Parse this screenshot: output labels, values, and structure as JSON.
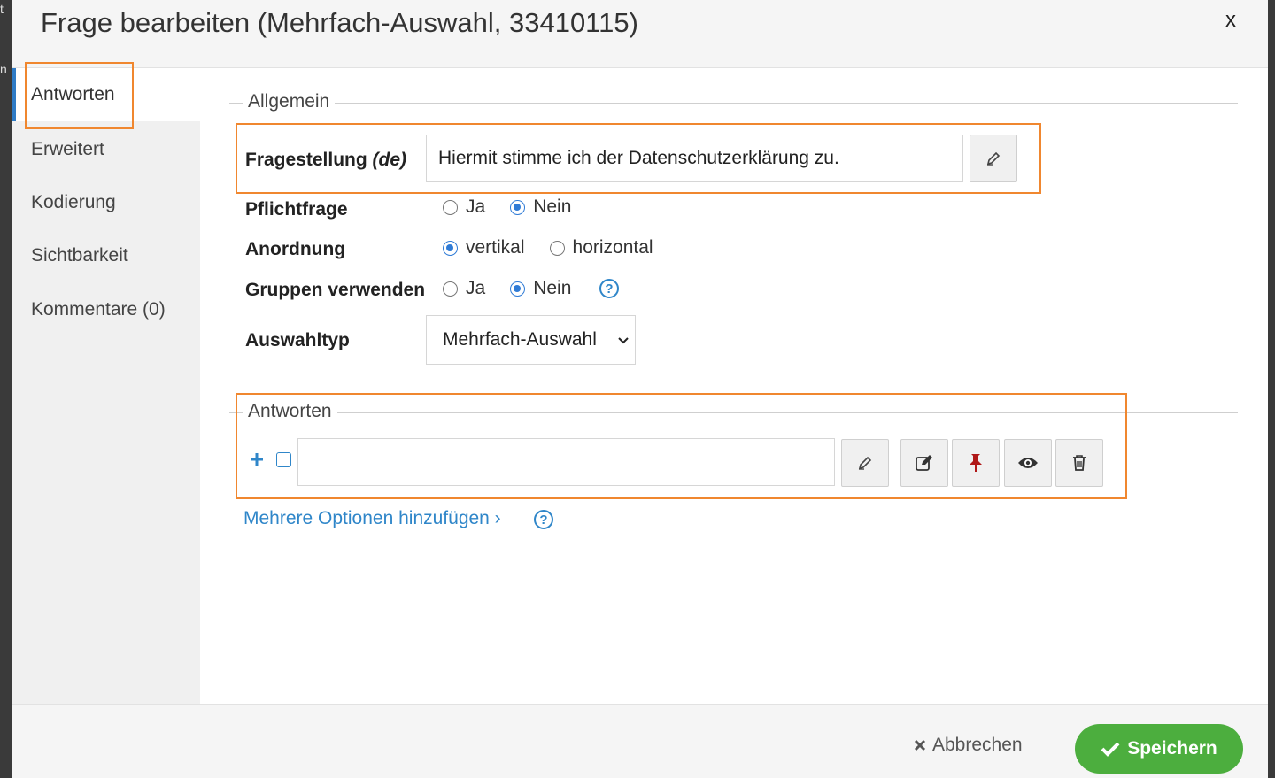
{
  "backdrop": {
    "frag_top": "t",
    "frag_mid": "n"
  },
  "dialog": {
    "title": "Frage bearbeiten (Mehrfach-Auswahl, 33410115)",
    "close_label": "x"
  },
  "sidebar": {
    "tabs": [
      {
        "label": "Antworten",
        "active": true
      },
      {
        "label": "Erweitert"
      },
      {
        "label": "Kodierung"
      },
      {
        "label": "Sichtbarkeit"
      },
      {
        "label": "Kommentare (0)"
      }
    ]
  },
  "general": {
    "legend": "Allgemein",
    "question_label": "Fragestellung",
    "question_lang": "(de)",
    "question_value": "Hiermit stimme ich der Datenschutzerklärung zu.",
    "mandatory": {
      "label": "Pflichtfrage",
      "options": [
        "Ja",
        "Nein"
      ],
      "selected": "Nein"
    },
    "arrangement": {
      "label": "Anordnung",
      "options": [
        "vertikal",
        "horizontal"
      ],
      "selected": "vertikal"
    },
    "groups": {
      "label": "Gruppen verwenden",
      "options": [
        "Ja",
        "Nein"
      ],
      "selected": "Nein"
    },
    "selection_type": {
      "label": "Auswahltyp",
      "value": "Mehrfach-Auswahl"
    }
  },
  "answers": {
    "legend": "Antworten",
    "answer_value": "",
    "add_multiple_link": "Mehrere Optionen hinzufügen ›"
  },
  "icons": {
    "pencil": "pencil-icon",
    "edit": "edit-icon",
    "pin": "pin-icon",
    "eye": "eye-icon",
    "trash": "trash-icon",
    "plus": "plus-icon",
    "help": "help-icon"
  },
  "colors": {
    "accent_blue": "#2f86c9",
    "highlight_orange": "#f0872f",
    "save_green": "#4cae3e",
    "pin_red": "#b01818"
  },
  "footer": {
    "cancel_label": "Abbrechen",
    "save_label": "Speichern"
  }
}
